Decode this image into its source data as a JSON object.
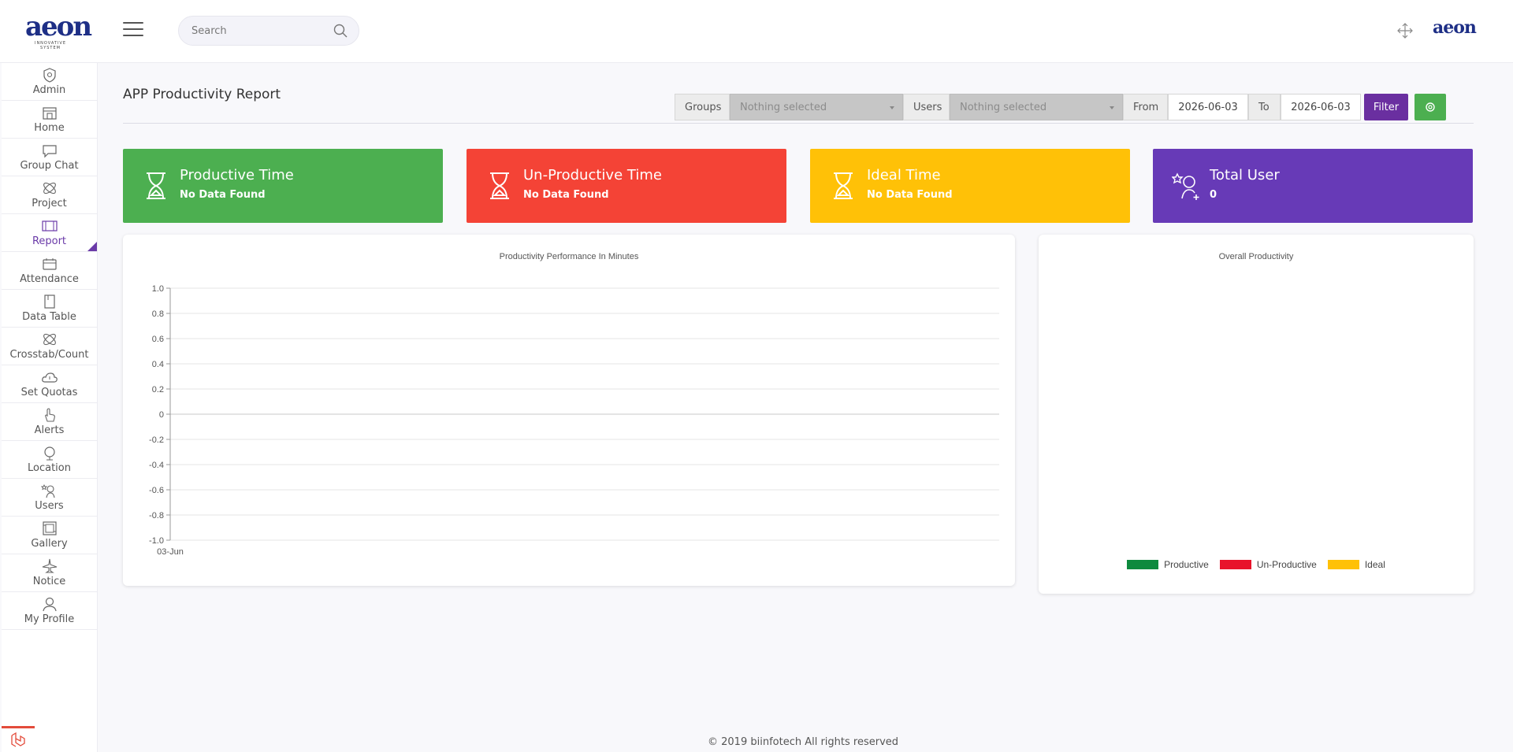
{
  "header": {
    "logo_text": "aeon",
    "logo_tagline": "INNOVATIVE SYSTEM",
    "search_placeholder": "Search",
    "brand_small": "aeon"
  },
  "sidebar": {
    "items": [
      {
        "label": "Admin",
        "icon": "admin-icon"
      },
      {
        "label": "Home",
        "icon": "home-icon"
      },
      {
        "label": "Group Chat",
        "icon": "chat-icon"
      },
      {
        "label": "Project",
        "icon": "project-icon"
      },
      {
        "label": "Report",
        "icon": "report-icon",
        "active": true
      },
      {
        "label": "Attendance",
        "icon": "attendance-icon"
      },
      {
        "label": "Data Table",
        "icon": "data-table-icon"
      },
      {
        "label": "Crosstab/Count",
        "icon": "crosstab-icon"
      },
      {
        "label": "Set Quotas",
        "icon": "cloud-icon"
      },
      {
        "label": "Alerts",
        "icon": "hand-icon"
      },
      {
        "label": "Location",
        "icon": "globe-icon"
      },
      {
        "label": "Users",
        "icon": "users-icon"
      },
      {
        "label": "Gallery",
        "icon": "gallery-icon"
      },
      {
        "label": "Notice",
        "icon": "plane-icon"
      },
      {
        "label": "My Profile",
        "icon": "profile-icon"
      }
    ]
  },
  "page": {
    "title": "APP Productivity Report"
  },
  "filters": {
    "groups_label": "Groups",
    "groups_value": "Nothing selected",
    "users_label": "Users",
    "users_value": "Nothing selected",
    "from_label": "From",
    "from_value": "2026-06-03",
    "to_label": "To",
    "to_value": "2026-06-03",
    "filter_button": "Filter"
  },
  "cards": [
    {
      "title": "Productive Time",
      "value": "No Data Found",
      "color": "#4caf50"
    },
    {
      "title": "Un-Productive Time",
      "value": "No Data Found",
      "color": "#f44336"
    },
    {
      "title": "Ideal Time",
      "value": "No Data Found",
      "color": "#ffc107"
    },
    {
      "title": "Total User",
      "value": "0",
      "color": "#673ab7"
    }
  ],
  "chart_data": [
    {
      "type": "line",
      "title": "Productivity Performance In Minutes",
      "categories": [
        "03-Jun"
      ],
      "y_ticks": [
        "1.0",
        "0.8",
        "0.6",
        "0.4",
        "0.2",
        "0",
        "-0.2",
        "-0.4",
        "-0.6",
        "-0.8",
        "-1.0"
      ],
      "ylim": [
        -1.0,
        1.0
      ],
      "series": [],
      "grid": true
    },
    {
      "type": "pie",
      "title": "Overall Productivity",
      "legend": [
        {
          "name": "Productive",
          "color": "#0e8a3e"
        },
        {
          "name": "Un-Productive",
          "color": "#e8132b"
        },
        {
          "name": "Ideal",
          "color": "#ffc107"
        }
      ],
      "legend_position": "bottom",
      "values": []
    }
  ],
  "footer": {
    "text": "© 2019 biinfotech All rights reserved"
  }
}
